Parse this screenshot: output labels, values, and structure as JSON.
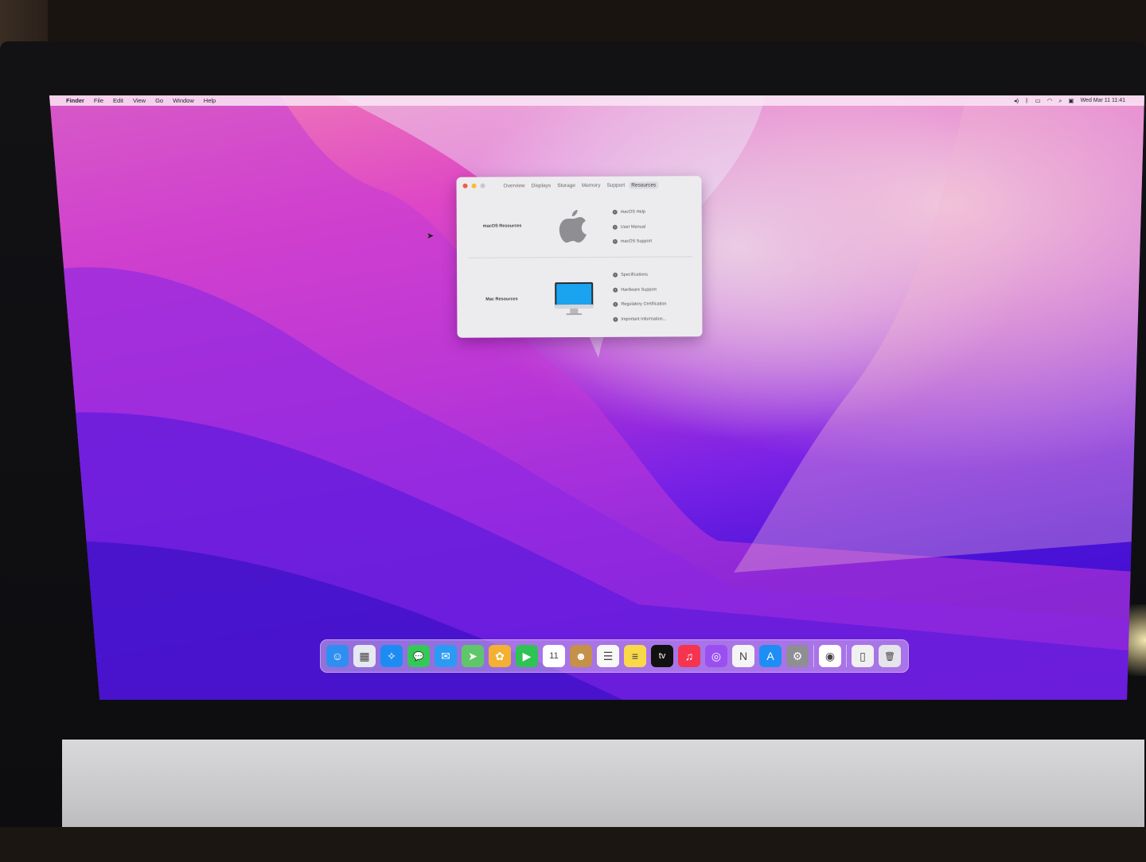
{
  "menubar": {
    "app_name": "Finder",
    "items": [
      "File",
      "Edit",
      "View",
      "Go",
      "Window",
      "Help"
    ],
    "clock": "Wed Mar 11 11:41"
  },
  "window": {
    "tabs": [
      "Overview",
      "Displays",
      "Storage",
      "Memory",
      "Support",
      "Resources"
    ],
    "active_tab": "Resources",
    "macos_section": {
      "label": "macOS Resources",
      "links": [
        "macOS Help",
        "User Manual",
        "macOS Support"
      ]
    },
    "mac_section": {
      "label": "Mac Resources",
      "links": [
        "Specifications",
        "Hardware Support",
        "Regulatory Certification",
        "Important Information..."
      ]
    }
  },
  "dock": {
    "apps": [
      {
        "name": "finder-icon",
        "color": "#2f8ff0",
        "glyph": "☺"
      },
      {
        "name": "launchpad-icon",
        "color": "#e6e9f2",
        "glyph": "▦"
      },
      {
        "name": "safari-icon",
        "color": "#1d8cf2",
        "glyph": "✧"
      },
      {
        "name": "messages-icon",
        "color": "#36c759",
        "glyph": "💬"
      },
      {
        "name": "mail-icon",
        "color": "#2b9af3",
        "glyph": "✉"
      },
      {
        "name": "maps-icon",
        "color": "#5fc76a",
        "glyph": "➤"
      },
      {
        "name": "photos-icon",
        "color": "#f3b033",
        "glyph": "✿"
      },
      {
        "name": "facetime-icon",
        "color": "#2fc254",
        "glyph": "▶"
      },
      {
        "name": "calendar-icon",
        "color": "#ffffff",
        "glyph": "11"
      },
      {
        "name": "contacts-icon",
        "color": "#c4904a",
        "glyph": "☻"
      },
      {
        "name": "reminders-icon",
        "color": "#f7f7f7",
        "glyph": "☰"
      },
      {
        "name": "notes-icon",
        "color": "#f9d94a",
        "glyph": "≡"
      },
      {
        "name": "tv-icon",
        "color": "#111111",
        "glyph": "tv"
      },
      {
        "name": "music-icon",
        "color": "#f5344f",
        "glyph": "♫"
      },
      {
        "name": "podcasts-icon",
        "color": "#9b4ff0",
        "glyph": "◎"
      },
      {
        "name": "news-icon",
        "color": "#f4f4f4",
        "glyph": "N"
      },
      {
        "name": "app-store-icon",
        "color": "#1e8ef4",
        "glyph": "A"
      },
      {
        "name": "system-preferences-icon",
        "color": "#8e8e93",
        "glyph": "⚙"
      }
    ],
    "extra_apps": [
      {
        "name": "chrome-icon",
        "color": "#ffffff",
        "glyph": "◉"
      }
    ],
    "trailing": [
      {
        "name": "archive-icon",
        "color": "#f0f0f0",
        "glyph": "▯"
      },
      {
        "name": "trash-icon",
        "color": "#e4e4ea",
        "glyph": "🗑"
      }
    ]
  }
}
